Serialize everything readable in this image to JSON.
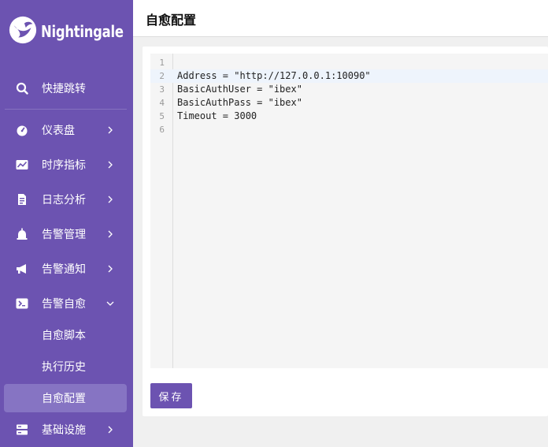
{
  "brand": {
    "name": "Nightingale"
  },
  "sidebar": {
    "quick_jump": "快捷跳转",
    "items": [
      {
        "label": "仪表盘",
        "icon": "dashboard-icon"
      },
      {
        "label": "时序指标",
        "icon": "line-chart-icon"
      },
      {
        "label": "日志分析",
        "icon": "log-file-icon"
      },
      {
        "label": "告警管理",
        "icon": "alarm-bell-icon"
      },
      {
        "label": "告警通知",
        "icon": "megaphone-icon"
      },
      {
        "label": "告警自愈",
        "icon": "terminal-icon",
        "expanded": true,
        "children": [
          {
            "label": "自愈脚本"
          },
          {
            "label": "执行历史"
          },
          {
            "label": "自愈配置",
            "active": true
          }
        ]
      },
      {
        "label": "基础设施",
        "icon": "infrastructure-icon"
      }
    ]
  },
  "header": {
    "title": "自愈配置"
  },
  "editor": {
    "lines": [
      {
        "num": "1",
        "code": ""
      },
      {
        "num": "2",
        "code": "Address = \"http://127.0.0.1:10090\""
      },
      {
        "num": "3",
        "code": "BasicAuthUser = \"ibex\""
      },
      {
        "num": "4",
        "code": "BasicAuthPass = \"ibex\""
      },
      {
        "num": "5",
        "code": "Timeout = 3000"
      },
      {
        "num": "6",
        "code": ""
      }
    ],
    "current_line": 2
  },
  "actions": {
    "save_label": "保存"
  },
  "colors": {
    "sidebar": "#6c53b1",
    "active_item": "#8674c3",
    "primary_button": "#6c53b1"
  }
}
